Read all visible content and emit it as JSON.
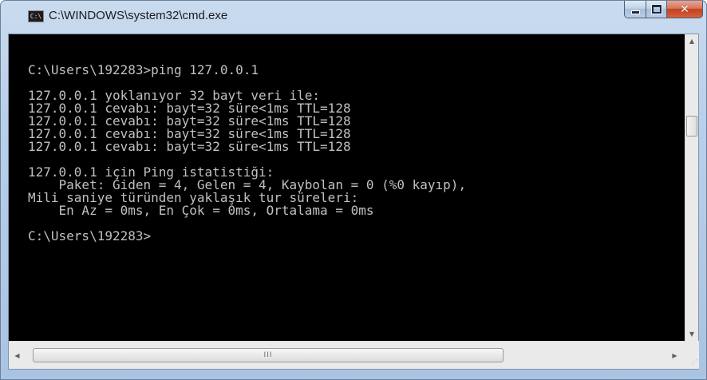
{
  "window": {
    "title": "C:\\WINDOWS\\system32\\cmd.exe",
    "icon_label": "C:\\"
  },
  "console": {
    "lines": [
      "C:\\Users\\192283>ping 127.0.0.1",
      "",
      "127.0.0.1 yoklanıyor 32 bayt veri ile:",
      "127.0.0.1 cevabı: bayt=32 süre<1ms TTL=128",
      "127.0.0.1 cevabı: bayt=32 süre<1ms TTL=128",
      "127.0.0.1 cevabı: bayt=32 süre<1ms TTL=128",
      "127.0.0.1 cevabı: bayt=32 süre<1ms TTL=128",
      "",
      "127.0.0.1 için Ping istatistiği:",
      "    Paket: Giden = 4, Gelen = 4, Kaybolan = 0 (%0 kayıp),",
      "Mili saniye türünden yaklaşık tur süreleri:",
      "    En Az = 0ms, En Çok = 0ms, Ortalama = 0ms",
      "",
      "C:\\Users\\192283>"
    ]
  },
  "icons": {
    "minimize": "minimize-icon",
    "maximize": "maximize-icon",
    "close": "close-icon",
    "scroll_up": "chevron-up-icon",
    "scroll_down": "chevron-down-icon",
    "scroll_left": "chevron-left-icon",
    "scroll_right": "chevron-right-icon"
  },
  "colors": {
    "console_background": "#000000",
    "console_text": "#c0c0c0",
    "close_button": "#c7452a"
  }
}
